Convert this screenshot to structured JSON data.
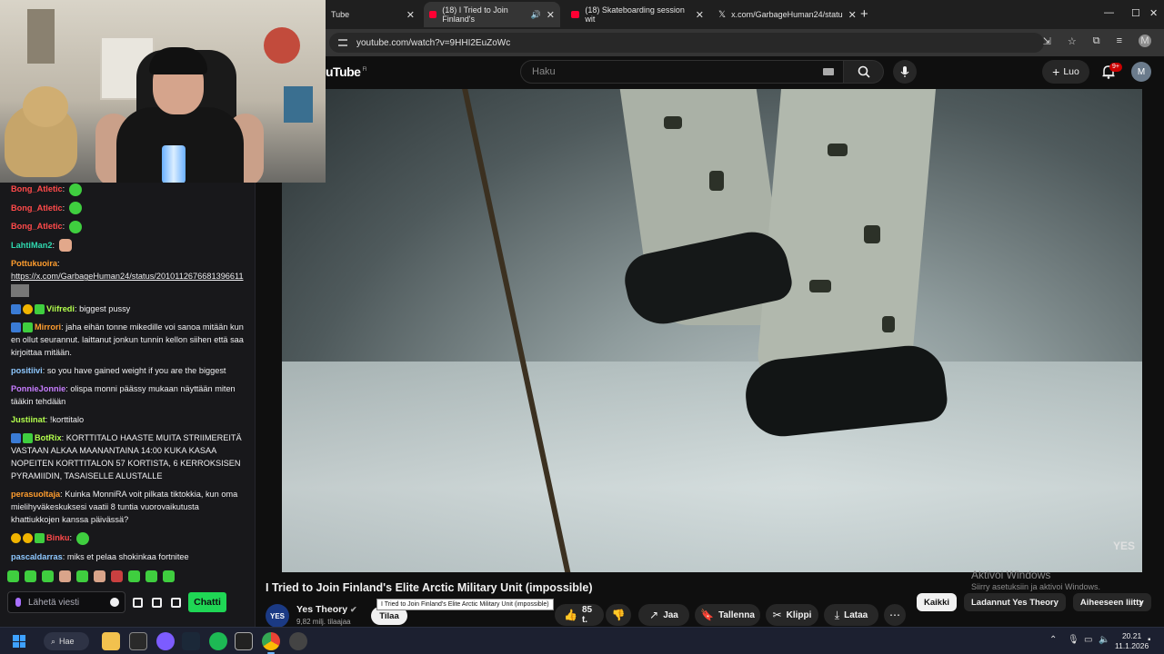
{
  "browser": {
    "tabs": [
      {
        "label": "Tube",
        "favicon": "youtube-icon"
      },
      {
        "label": "(18) I Tried to Join Finland's",
        "favicon": "youtube-icon",
        "active": true,
        "audio": true
      },
      {
        "label": "(18) Skateboarding session wit",
        "favicon": "youtube-icon"
      },
      {
        "label": "x.com/GarbageHuman24/statu",
        "favicon": "x-icon"
      }
    ],
    "url": "youtube.com/watch?v=9HHI2EuZoWc",
    "profile_initial": "M"
  },
  "youtube": {
    "logo": "uTube",
    "logo_region": "FI",
    "search_placeholder": "Haku",
    "create_label": "Luo",
    "notifications_badge": "9+",
    "avatar_initial": "M",
    "watermark": "YES",
    "video_title": "I Tried to Join Finland's Elite Arctic Military Unit (impossible)",
    "tooltip": "I Tried to Join Finland's Elite Arctic Military Unit (impossible)",
    "channel": {
      "name": "Yes Theory",
      "subscribers": "9,82 milj. tilaajaa",
      "avatar_text": "YES",
      "subscribe_label": "Tilaa"
    },
    "actions": {
      "likes": "85 t.",
      "share": "Jaa",
      "save": "Tallenna",
      "clip": "Klippi",
      "download": "Lataa"
    },
    "chips": [
      "Kaikki",
      "Ladannut Yes Theory",
      "Aiheeseen liitty"
    ]
  },
  "windows_activation": {
    "title": "Aktivoi Windows",
    "subtitle": "Siirry asetuksiin ja aktivoi Windows."
  },
  "chat": {
    "messages": [
      {
        "user": "Bong_Atletic",
        "color": "#ff4a4a",
        "text": "",
        "emote": true
      },
      {
        "user": "Bong_Atletic",
        "color": "#ff4a4a",
        "text": "",
        "emote": true
      },
      {
        "user": "Bong_Atletic",
        "color": "#ff4a4a",
        "text": "",
        "emote": true
      },
      {
        "user": "LahtiMan2",
        "color": "#2fd9b0",
        "text": "",
        "emote_face": true
      },
      {
        "user": "Pottukuoira",
        "color": "#ff9d2e",
        "text": "",
        "link": "https://x.com/GarbageHuman24/status/2010112676681396611",
        "thumb": true
      },
      {
        "user": "Viifredi",
        "color": "#b3ff4d",
        "text": "biggest pussy",
        "badges": [
          "b1",
          "b2",
          "b3"
        ]
      },
      {
        "user": "Mirrori",
        "color": "#ff9d2e",
        "text": "jaha eihän tonne mikedille voi sanoa mitään kun en ollut seurannut. laittanut jonkun tunnin kellon siihen että saa kirjoittaa mitään.",
        "badges": [
          "b1",
          "b3"
        ]
      },
      {
        "user": "positiivi",
        "color": "#8ec8ff",
        "text": "so you have gained weight if you are the biggest"
      },
      {
        "user": "PonnieJonnie",
        "color": "#c77dff",
        "text": "olispa monni päässy mukaan näyttään miten tääkin tehdään"
      },
      {
        "user": "Justiinat",
        "color": "#b3ff4d",
        "text": "!korttitalo"
      },
      {
        "user": "BotRix",
        "color": "#b3ff4d",
        "text": "KORTTITALO HAASTE MUITA STRIIMEREITÄ VASTAAN ALKAA MAANANTAINA 14:00 KUKA KASAA NOPEITEN KORTTITALON 57 KORTISTA, 6 KERROKSISEN PYRAMIIDIN, TASAISELLE ALUSTALLE",
        "badges": [
          "b1",
          "b3"
        ]
      },
      {
        "user": "perasuoltaja",
        "color": "#ff9d2e",
        "text": "Kuinka MonniRA voit pilkata tiktokkia, kun oma mielihyväkeskuksesi vaatii 8 tuntia vuorovaikutusta khattiukkojen kanssa päivässä?"
      },
      {
        "user": "Binku",
        "color": "#ff4a4a",
        "text": "",
        "badges": [
          "b2",
          "b2",
          "b3"
        ],
        "emote": true
      },
      {
        "user": "pascaldarras",
        "color": "#8ec8ff",
        "text": "miks et pelaa shokinkaa fortnitee"
      }
    ],
    "input_placeholder": "Lähetä viesti",
    "send_label": "Chatti"
  },
  "taskbar": {
    "search_label": "Hae",
    "time": "20.21",
    "date": "11.1.2026"
  }
}
